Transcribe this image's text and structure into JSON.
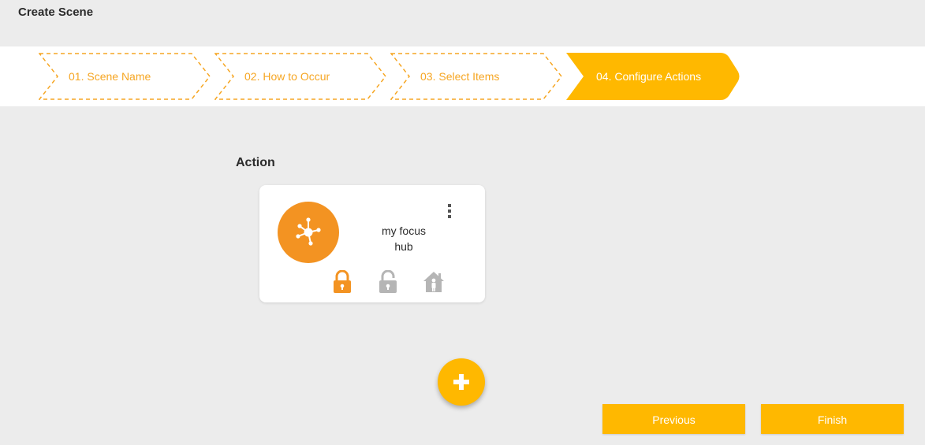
{
  "page": {
    "title": "Create Scene"
  },
  "stepper": {
    "steps": [
      {
        "label": "01. Scene Name",
        "state": "inactive"
      },
      {
        "label": "02. How to Occur",
        "state": "inactive"
      },
      {
        "label": "03. Select Items",
        "state": "inactive"
      },
      {
        "label": "04. Configure Actions",
        "state": "active"
      }
    ],
    "accent_color": "#f6a623",
    "active_color": "#ffb800"
  },
  "action_section": {
    "title": "Action",
    "card": {
      "device_name": "my focus hub",
      "device_icon": "hub-icon",
      "device_color": "#f39322",
      "actions": [
        {
          "icon": "lock-icon",
          "state": "selected",
          "color": "#f39322"
        },
        {
          "icon": "unlock-icon",
          "state": "unselected",
          "color": "#b5b5b5"
        },
        {
          "icon": "home-person-icon",
          "state": "unselected",
          "color": "#b5b5b5"
        }
      ],
      "menu_icon": "more-vertical-icon"
    }
  },
  "add_button": {
    "icon": "plus-icon"
  },
  "footer": {
    "previous_label": "Previous",
    "finish_label": "Finish",
    "button_color": "#ffb800"
  }
}
